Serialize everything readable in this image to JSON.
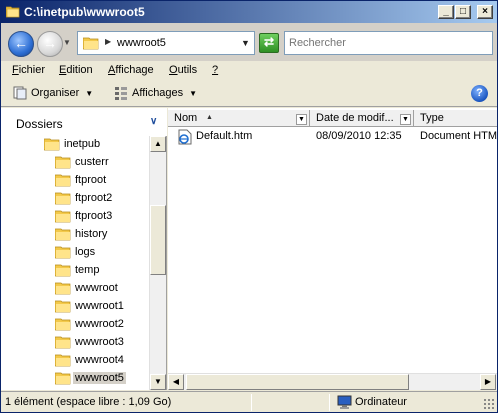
{
  "window": {
    "title": "C:\\inetpub\\wwwroot5"
  },
  "address_bar": {
    "path": "wwwroot5",
    "search_placeholder": "Rechercher"
  },
  "menu": {
    "items": [
      {
        "label": "Fichier"
      },
      {
        "label": "Edition"
      },
      {
        "label": "Affichage"
      },
      {
        "label": "Outils"
      },
      {
        "label": "?"
      }
    ]
  },
  "toolbar": {
    "organize_label": "Organiser",
    "views_label": "Affichages"
  },
  "tree": {
    "header": "Dossiers",
    "parent": "inetpub",
    "items": [
      {
        "label": "custerr"
      },
      {
        "label": "ftproot"
      },
      {
        "label": "ftproot2"
      },
      {
        "label": "ftproot3"
      },
      {
        "label": "history"
      },
      {
        "label": "logs"
      },
      {
        "label": "temp"
      },
      {
        "label": "wwwroot"
      },
      {
        "label": "wwwroot1"
      },
      {
        "label": "wwwroot2"
      },
      {
        "label": "wwwroot3"
      },
      {
        "label": "wwwroot4"
      },
      {
        "label": "wwwroot5",
        "selected": true
      }
    ]
  },
  "file_list": {
    "columns": {
      "name": "Nom",
      "date": "Date de modif...",
      "type": "Type"
    },
    "rows": [
      {
        "name": "Default.htm",
        "date": "08/09/2010 12:35",
        "type": "Document HTML"
      }
    ]
  },
  "status": {
    "left": "1 élément (espace libre : 1,09 Go)",
    "right": "Ordinateur"
  },
  "colors": {
    "title_bar": "#0a246a",
    "window_bg": "#ece9d8",
    "folder_yellow": "#f3c94a"
  }
}
